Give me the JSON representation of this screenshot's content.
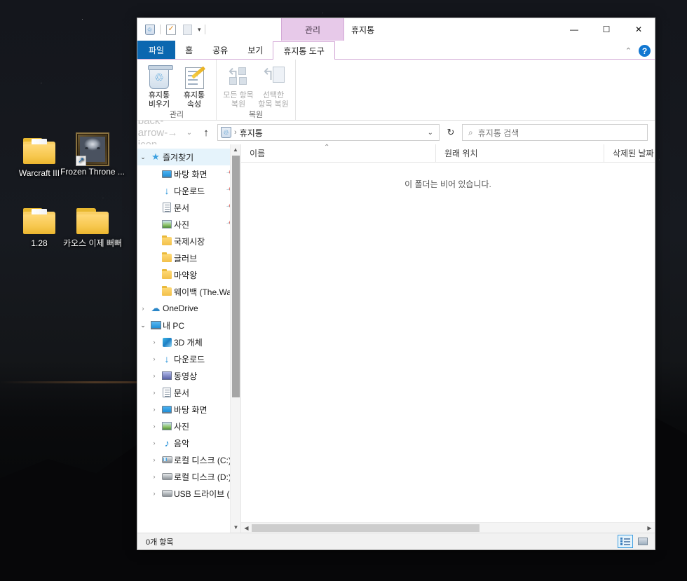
{
  "desktop": {
    "icons": [
      {
        "name": "Warcraft III",
        "type": "folder-with-files"
      },
      {
        "name": "Frozen Throne ...",
        "type": "shortcut-portrait"
      },
      {
        "name": "1.28",
        "type": "folder-with-files"
      },
      {
        "name": "카오스 이제 뻐뻐",
        "type": "folder"
      }
    ]
  },
  "window": {
    "title": "휴지통",
    "contextual_tab_group": "관리",
    "quick_access": {
      "recycle_bin_icon": "recycle-bin-icon",
      "properties_icon": "properties-icon",
      "blank_icon": "blank-tile-icon",
      "dropdown_icon": "chevron-down-icon"
    },
    "controls": {
      "minimize": "—",
      "maximize": "☐",
      "close": "✕",
      "collapse_ribbon": "⌃",
      "help": "?"
    }
  },
  "tabs": [
    {
      "label": "파일",
      "kind": "file"
    },
    {
      "label": "홈",
      "kind": "normal"
    },
    {
      "label": "공유",
      "kind": "normal"
    },
    {
      "label": "보기",
      "kind": "normal"
    },
    {
      "label": "휴지통 도구",
      "kind": "contextual-active"
    }
  ],
  "ribbon": {
    "groups": [
      {
        "label": "관리",
        "buttons": [
          {
            "line1": "휴지통",
            "line2": "비우기",
            "icon": "recycle-bin-icon",
            "disabled": false
          },
          {
            "line1": "휴지통",
            "line2": "속성",
            "icon": "properties-icon",
            "disabled": false
          }
        ]
      },
      {
        "label": "복원",
        "buttons": [
          {
            "line1": "모든 항목",
            "line2": "복원",
            "icon": "restore-all-icon",
            "disabled": true
          },
          {
            "line1": "선택한",
            "line2": "항목 복원",
            "icon": "restore-selected-icon",
            "disabled": true
          }
        ]
      }
    ]
  },
  "addressbar": {
    "back_icon": "back-arrow-icon",
    "forward_icon": "forward-arrow-icon",
    "recent_icon": "chevron-down-icon",
    "up_icon": "up-arrow-icon",
    "crumb_icon": "recycle-bin-icon",
    "crumb_separator": "›",
    "path": "휴지통",
    "dropdown_icon": "chevron-down-icon",
    "refresh_icon": "refresh-icon"
  },
  "search": {
    "icon": "search-icon",
    "placeholder": "휴지통 검색"
  },
  "navpane": {
    "items": [
      {
        "label": "즐겨찾기",
        "icon": "favorites-star-icon",
        "indent": 0,
        "chevron": "open",
        "selected": true,
        "pinned": false
      },
      {
        "label": "바탕 화면",
        "icon": "desktop-icon",
        "indent": 1,
        "chevron": "none",
        "selected": false,
        "pinned": true
      },
      {
        "label": "다운로드",
        "icon": "downloads-icon",
        "indent": 1,
        "chevron": "none",
        "selected": false,
        "pinned": true
      },
      {
        "label": "문서",
        "icon": "documents-icon",
        "indent": 1,
        "chevron": "none",
        "selected": false,
        "pinned": true
      },
      {
        "label": "사진",
        "icon": "pictures-icon",
        "indent": 1,
        "chevron": "none",
        "selected": false,
        "pinned": true
      },
      {
        "label": "국제시장",
        "icon": "folder-icon",
        "indent": 1,
        "chevron": "none",
        "selected": false,
        "pinned": false
      },
      {
        "label": "글러브",
        "icon": "folder-icon",
        "indent": 1,
        "chevron": "none",
        "selected": false,
        "pinned": false
      },
      {
        "label": "마약왕",
        "icon": "folder-icon",
        "indent": 1,
        "chevron": "none",
        "selected": false,
        "pinned": false
      },
      {
        "label": "웨이백 (The.Way)",
        "icon": "folder-icon",
        "indent": 1,
        "chevron": "none",
        "selected": false,
        "pinned": false
      },
      {
        "label": "OneDrive",
        "icon": "onedrive-cloud-icon",
        "indent": 0,
        "chevron": "closed",
        "selected": false,
        "pinned": false
      },
      {
        "label": "내 PC",
        "icon": "this-pc-icon",
        "indent": 0,
        "chevron": "open",
        "selected": false,
        "pinned": false
      },
      {
        "label": "3D 개체",
        "icon": "3d-objects-icon",
        "indent": 1,
        "chevron": "closed",
        "selected": false,
        "pinned": false
      },
      {
        "label": "다운로드",
        "icon": "downloads-icon",
        "indent": 1,
        "chevron": "closed",
        "selected": false,
        "pinned": false
      },
      {
        "label": "동영상",
        "icon": "videos-icon",
        "indent": 1,
        "chevron": "closed",
        "selected": false,
        "pinned": false
      },
      {
        "label": "문서",
        "icon": "documents-icon",
        "indent": 1,
        "chevron": "closed",
        "selected": false,
        "pinned": false
      },
      {
        "label": "바탕 화면",
        "icon": "desktop-icon",
        "indent": 1,
        "chevron": "closed",
        "selected": false,
        "pinned": false
      },
      {
        "label": "사진",
        "icon": "pictures-icon",
        "indent": 1,
        "chevron": "closed",
        "selected": false,
        "pinned": false
      },
      {
        "label": "음악",
        "icon": "music-icon",
        "indent": 1,
        "chevron": "closed",
        "selected": false,
        "pinned": false
      },
      {
        "label": "로컬 디스크 (C:)",
        "icon": "system-drive-icon",
        "indent": 1,
        "chevron": "closed",
        "selected": false,
        "pinned": false
      },
      {
        "label": "로컬 디스크 (D:)",
        "icon": "drive-icon",
        "indent": 1,
        "chevron": "closed",
        "selected": false,
        "pinned": false
      },
      {
        "label": "USB 드라이브 (E",
        "icon": "drive-icon",
        "indent": 1,
        "chevron": "closed",
        "selected": false,
        "pinned": false
      }
    ]
  },
  "filelist": {
    "columns": [
      {
        "label": "이름",
        "sorted": "asc"
      },
      {
        "label": "원래 위치",
        "sorted": "none"
      },
      {
        "label": "삭제된 날짜",
        "sorted": "none"
      }
    ],
    "empty_message": "이 폴더는 비어 있습니다."
  },
  "statusbar": {
    "item_count": "0개 항목",
    "views": [
      {
        "name": "details-view",
        "active": true
      },
      {
        "name": "large-icons-view",
        "active": false
      }
    ]
  },
  "colors": {
    "file_tab": "#0b67b0",
    "contextual": "#e7c9e9",
    "selection": "#e5f3fb",
    "accent": "#1177d1"
  }
}
